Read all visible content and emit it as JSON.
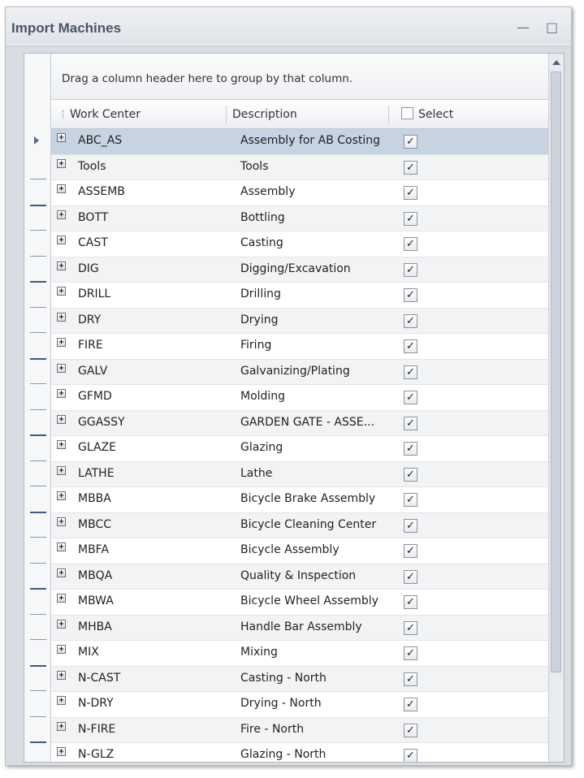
{
  "window": {
    "title": "Import Machines",
    "minimize_glyph": "—",
    "maximize_glyph": "□"
  },
  "grid": {
    "group_panel_text": "Drag a column header here to group by that column.",
    "columns": {
      "work_center": "Work Center",
      "description": "Description",
      "select": "Select"
    },
    "selected_row_index": 0,
    "rows": [
      {
        "work_center": "ABC_AS",
        "description": "Assembly for AB Costing",
        "checked": true
      },
      {
        "work_center": "Tools",
        "description": "Tools",
        "checked": true
      },
      {
        "work_center": "ASSEMB",
        "description": "Assembly",
        "checked": true
      },
      {
        "work_center": "BOTT",
        "description": "Bottling",
        "checked": true
      },
      {
        "work_center": "CAST",
        "description": "Casting",
        "checked": true
      },
      {
        "work_center": "DIG",
        "description": "Digging/Excavation",
        "checked": true
      },
      {
        "work_center": "DRILL",
        "description": "Drilling",
        "checked": true
      },
      {
        "work_center": "DRY",
        "description": "Drying",
        "checked": true
      },
      {
        "work_center": "FIRE",
        "description": "Firing",
        "checked": true
      },
      {
        "work_center": "GALV",
        "description": "Galvanizing/Plating",
        "checked": true
      },
      {
        "work_center": "GFMD",
        "description": "Molding",
        "checked": true
      },
      {
        "work_center": "GGASSY",
        "description": "GARDEN GATE - ASSE...",
        "checked": true
      },
      {
        "work_center": "GLAZE",
        "description": "Glazing",
        "checked": true
      },
      {
        "work_center": "LATHE",
        "description": "Lathe",
        "checked": true
      },
      {
        "work_center": "MBBA",
        "description": "Bicycle Brake Assembly",
        "checked": true
      },
      {
        "work_center": "MBCC",
        "description": "Bicycle Cleaning Center",
        "checked": true
      },
      {
        "work_center": "MBFA",
        "description": "Bicycle Assembly",
        "checked": true
      },
      {
        "work_center": "MBQA",
        "description": "Quality & Inspection",
        "checked": true
      },
      {
        "work_center": "MBWA",
        "description": "Bicycle Wheel Assembly",
        "checked": true
      },
      {
        "work_center": "MHBA",
        "description": "Handle Bar Assembly",
        "checked": true
      },
      {
        "work_center": "MIX",
        "description": "Mixing",
        "checked": true
      },
      {
        "work_center": "N-CAST",
        "description": "Casting - North",
        "checked": true
      },
      {
        "work_center": "N-DRY",
        "description": "Drying - North",
        "checked": true
      },
      {
        "work_center": "N-FIRE",
        "description": "Fire - North",
        "checked": true
      },
      {
        "work_center": "N-GLZ",
        "description": "Glazing - North",
        "checked": true
      }
    ]
  },
  "icons": {
    "expander": "plus-expander-icon",
    "checkmark": "✓",
    "row_indicator": "current-row-arrow-icon"
  },
  "colors": {
    "selected_row": "#c6d3e2",
    "title_text": "#4b5563",
    "alt_row": "#f2f3f5"
  }
}
